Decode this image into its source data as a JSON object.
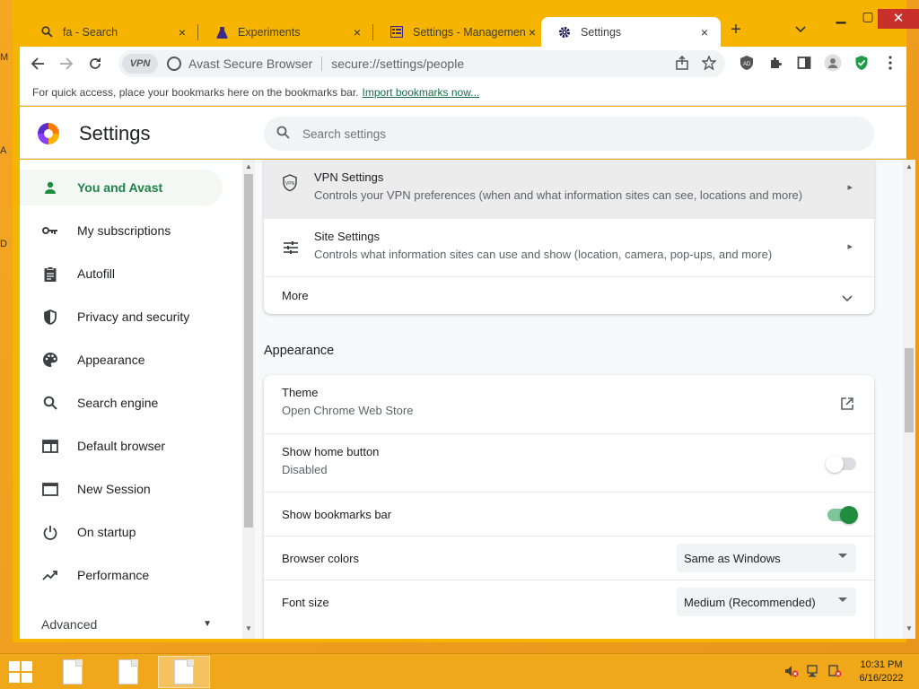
{
  "desktop": {
    "edge_letters": [
      "M",
      "A",
      "D"
    ]
  },
  "tabs": [
    {
      "title": "fa - Search",
      "icon": "search-icon",
      "close": "×"
    },
    {
      "title": "Experiments",
      "icon": "flask-icon",
      "close": "×"
    },
    {
      "title": "Settings - Management",
      "icon": "management-icon",
      "close": "×"
    },
    {
      "title": "Settings",
      "icon": "gear-icon",
      "close": "×"
    }
  ],
  "window_controls": {
    "minimize": "▁",
    "maximize": "▢",
    "close": "✕"
  },
  "toolbar": {
    "vpn_label": "VPN",
    "brand": "Avast Secure Browser",
    "url": "secure://settings/people"
  },
  "bookmarks_bar": {
    "hint": "For quick access, place your bookmarks here on the bookmarks bar.",
    "import_link": "Import bookmarks now..."
  },
  "header": {
    "title": "Settings",
    "search_placeholder": "Search settings"
  },
  "sidebar": {
    "items": [
      {
        "label": "You and Avast",
        "icon": "person-icon",
        "active": true
      },
      {
        "label": "My subscriptions",
        "icon": "key-icon"
      },
      {
        "label": "Autofill",
        "icon": "clipboard-icon"
      },
      {
        "label": "Privacy and security",
        "icon": "shield-icon"
      },
      {
        "label": "Appearance",
        "icon": "palette-icon"
      },
      {
        "label": "Search engine",
        "icon": "search-icon"
      },
      {
        "label": "Default browser",
        "icon": "browser-icon"
      },
      {
        "label": "New Session",
        "icon": "window-icon"
      },
      {
        "label": "On startup",
        "icon": "power-icon"
      },
      {
        "label": "Performance",
        "icon": "trending-icon"
      }
    ],
    "advanced": "Advanced"
  },
  "privacy_card": {
    "rows": [
      {
        "title": "VPN Settings",
        "subtitle": "Controls your VPN preferences (when and what information sites can see, locations and more)"
      },
      {
        "title": "Site Settings",
        "subtitle": "Controls what information sites can use and show (location, camera, pop-ups, and more)"
      }
    ],
    "more": "More"
  },
  "appearance": {
    "section_title": "Appearance",
    "theme": {
      "title": "Theme",
      "subtitle": "Open Chrome Web Store"
    },
    "home_button": {
      "title": "Show home button",
      "subtitle": "Disabled",
      "enabled": false
    },
    "bookmarks_bar": {
      "title": "Show bookmarks bar",
      "enabled": true
    },
    "browser_colors": {
      "title": "Browser colors",
      "value": "Same as Windows"
    },
    "font_size": {
      "title": "Font size",
      "value": "Medium (Recommended)"
    }
  },
  "colors": {
    "accent_green": "#1e8e3e",
    "toggle_on_track": "#7fc59b",
    "window_frame": "#f6b400"
  },
  "taskbar": {
    "time": "10:31 PM",
    "date": "6/16/2022"
  }
}
